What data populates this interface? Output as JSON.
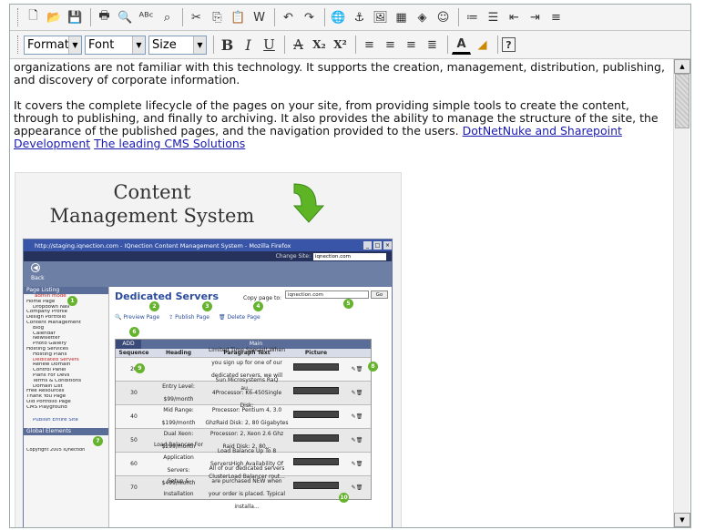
{
  "toolbar1": {
    "icons": [
      "new-page-icon",
      "open-folder-icon",
      "save-icon",
      "print-icon",
      "print-preview-icon",
      "spellcheck-icon",
      "find-icon",
      "cut-icon",
      "copy-icon",
      "paste-icon",
      "paste-word-icon",
      "undo-icon",
      "redo-icon",
      "link-icon",
      "anchor-icon",
      "image-icon",
      "table-icon",
      "media-icon",
      "smiley-icon",
      "ordered-list-icon",
      "unordered-list-icon",
      "outdent-icon",
      "indent-icon",
      "special-list-icon"
    ],
    "glyphs": [
      "🗋",
      "📂",
      "💾",
      "🖶",
      "🔍",
      "ᴬᴮᶜ",
      "⌕",
      "✂",
      "⎘",
      "📋",
      "W",
      "↶",
      "↷",
      "🌐",
      "⚓",
      "🖼",
      "▦",
      "◈",
      "☺",
      "≔",
      "☰",
      "⇤",
      "⇥",
      "≡"
    ]
  },
  "toolbar2": {
    "format_label": "Format",
    "font_label": "Font",
    "size_label": "Size",
    "bold": "B",
    "italic": "I",
    "underline": "U",
    "strike": "A",
    "subscript": "X₂",
    "superscript": "X²",
    "help": "?"
  },
  "content": {
    "para1": "organizations are not familiar with this technology. It supports the creation, management, distribution, publishing, and discovery of corporate information.",
    "para2_text": "It covers the complete lifecycle of the pages on your site, from providing simple tools to create the content, through to publishing, and finally to archiving. It also provides the ability to manage the structure of the site, the appearance of the published pages, and the navigation provided to the users.",
    "link1": "DotNetNuke and Sharepoint Development",
    "link2": "The leading CMS Solutions"
  },
  "cms_image": {
    "title_line1": "Content",
    "title_line2": "Management System",
    "window_title": "http://staging.iqnection.com - IQnection Content Management System - Mozilla Firefox",
    "change_site_label": "Change Site:",
    "change_site_value": "iqnection.com",
    "back_label": "Back",
    "page_listing": "Page Listing",
    "admin_mode": "admin mode",
    "tree": [
      {
        "label": "Home Page",
        "sub": false
      },
      {
        "label": "Dropdown Nav",
        "sub": true
      },
      {
        "label": "Company Profile",
        "sub": false
      },
      {
        "label": "Design Portfolio",
        "sub": false
      },
      {
        "label": "Content Management",
        "sub": false
      },
      {
        "label": "Blog",
        "sub": true
      },
      {
        "label": "Calendar",
        "sub": true
      },
      {
        "label": "Newsletter",
        "sub": true
      },
      {
        "label": "Photo Gallery",
        "sub": true
      },
      {
        "label": "Hosting Services",
        "sub": false
      },
      {
        "label": "Hosting Plans",
        "sub": true
      },
      {
        "label": "Dedicated Servers",
        "sub": true,
        "red": true
      },
      {
        "label": "Renew Domain",
        "sub": true
      },
      {
        "label": "Control Panel",
        "sub": true
      },
      {
        "label": "Plans For Devs",
        "sub": true
      },
      {
        "label": "Terms & Conditions",
        "sub": true
      },
      {
        "label": "Domain List",
        "sub": true
      },
      {
        "label": "Free Resources",
        "sub": false
      },
      {
        "label": "Thank You Page",
        "sub": false
      },
      {
        "label": "Old Portfolio Page",
        "sub": false
      },
      {
        "label": "CMS Playground",
        "sub": false
      }
    ],
    "publish_entire": "Publish Entire Site",
    "global_elements": "Global Elements",
    "copyright": "Copyright 2005 IQnection",
    "page_title": "Dedicated Servers",
    "copy_page_label": "Copy page to:",
    "copy_page_value": "iqnection.com",
    "go_label": "Go",
    "preview": "Preview Page",
    "publish": "Publish Page",
    "delete": "Delete Page",
    "add": "ADD",
    "main_label": "Main",
    "columns": [
      "Sequence",
      "Heading",
      "Paragraph Text",
      "Picture"
    ],
    "rows": [
      {
        "seq": "20",
        "heading": "",
        "text": "Limited Time Special! When you sign up for one of our dedicated servers, we will au..."
      },
      {
        "seq": "30",
        "heading": "Entry Level: $99/month",
        "text": "Sun Microsystems RaQ 4Processor: K6-450Single Disk:"
      },
      {
        "seq": "40",
        "heading": "Mid Range: $199/month",
        "text": "Processor: Pentium 4, 3.0 GhzRaid Disk: 2, 80 Gigabytes"
      },
      {
        "seq": "50",
        "heading": "Dual Xeon: $299/month",
        "text": "Processor: 2, Xeon 2.6 Ghz Raid Disk: 2, 80..."
      },
      {
        "seq": "60",
        "heading": "Load Balancer For Application Servers: $499/month",
        "text": "Load Balance Up To 8 ServersHigh Availability Of ClusterLoad Balancer rout..."
      },
      {
        "seq": "70",
        "heading": "Setup & Installation",
        "text": "All of our dedicated servers are purchased NEW when your order is placed. Typical installa..."
      }
    ],
    "badges": [
      "1",
      "2",
      "3",
      "4",
      "5",
      "6",
      "7",
      "8",
      "9",
      "10"
    ]
  }
}
